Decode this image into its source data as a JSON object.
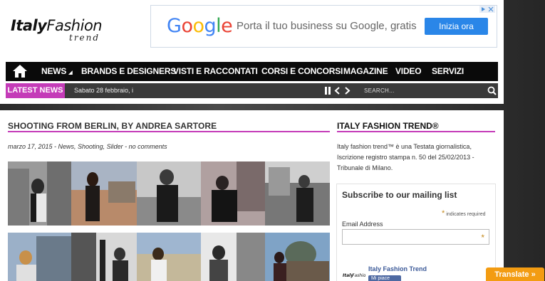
{
  "header": {
    "logo_word1": "Italy",
    "logo_word2": "Fashion",
    "logo_sub": "trend"
  },
  "ad": {
    "brand_letters": [
      "G",
      "o",
      "o",
      "g",
      "l",
      "e"
    ],
    "brand_colors": [
      "#4285F4",
      "#EA4335",
      "#FBBC05",
      "#4285F4",
      "#34A853",
      "#EA4335"
    ],
    "tagline": "Porta il tuo business su Google, gratis",
    "cta": "Inizia ora",
    "adchoices_icon": "ad-choices-icon"
  },
  "nav": {
    "home_icon": "home-icon",
    "items": [
      {
        "label": "NEWS"
      },
      {
        "label": "BRANDS E DESIGNERS"
      },
      {
        "label": "VISTI E RACCONTATI"
      },
      {
        "label": "CORSI E CONCORSI"
      },
      {
        "label": "MAGAZINE"
      },
      {
        "label": "VIDEO"
      },
      {
        "label": "SERVIZI"
      }
    ]
  },
  "ticker": {
    "label": "LATEST NEWS",
    "text": "Sabato 28 febbraio, i",
    "pause_icon": "pause-icon",
    "prev_icon": "chevron-left-icon",
    "next_icon": "chevron-right-icon",
    "search_placeholder": "SEARCH..."
  },
  "post": {
    "title": "SHOOTING FROM BERLIN, BY ANDREA SARTORE",
    "meta": "marzo 17, 2015 - News, Shooting, Slider - no comments"
  },
  "sidebar": {
    "title": "ITALY FASHION TREND®",
    "text": "Italy fashion trend™ è una Testata giornalistica, Iscrizione registro stampa n. 50 del 25/02/2013 - Tribunale di Milano.",
    "subscribe_title": "Subscribe to our mailing list",
    "required_note": "indicates required",
    "email_label": "Email Address",
    "fb_page_name": "Italy Fashion Trend",
    "fb_like": "Mi piace"
  },
  "translate": {
    "label": "Translate »"
  },
  "colors": {
    "accent": "#c43bb8",
    "cta": "#2a86e8",
    "translate": "#f39c12"
  }
}
